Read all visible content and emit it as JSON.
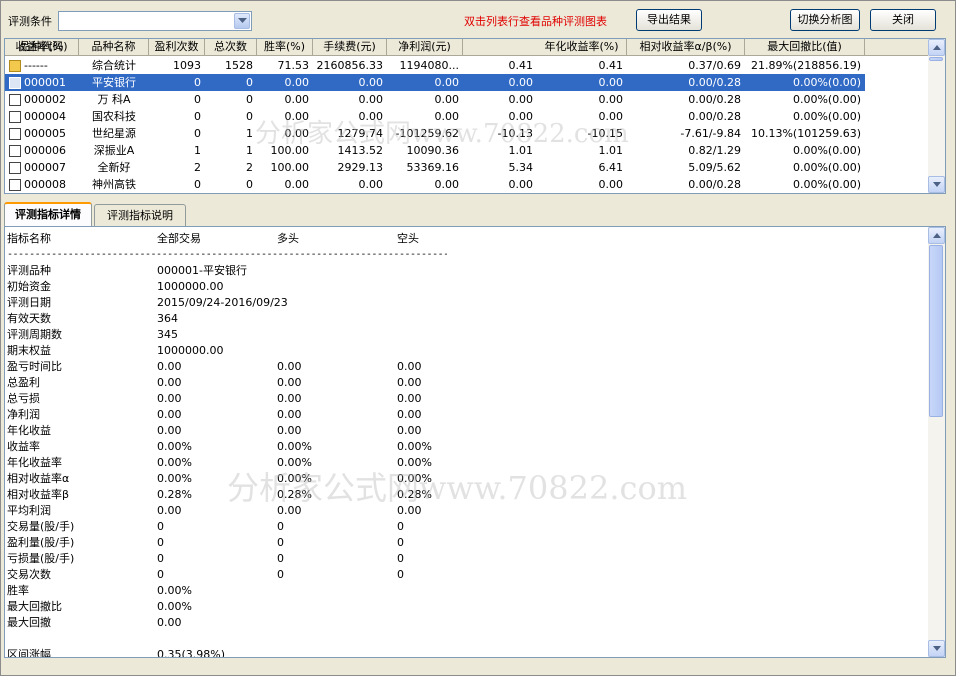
{
  "toolbar": {
    "condition_label": "评测条件",
    "condition_value": "",
    "hint": "双击列表行查看品种评测图表",
    "export_label": "导出结果",
    "switch_chart_label": "切换分析图",
    "close_label": "关闭"
  },
  "grid": {
    "columns": [
      "品种代码",
      "品种名称",
      "盈利次数",
      "总次数",
      "胜率(%)",
      "手续费(元)",
      "净利润(元)",
      "收益率(%)",
      "年化收益率(%)",
      "相对收益率α/β(%)",
      "最大回撤比(值)"
    ],
    "rows": [
      {
        "code": "------",
        "name": "综合统计",
        "wins": "1093",
        "total": "1528",
        "winrate": "71.53",
        "fee": "2160856.33",
        "profit": "1194080...",
        "ret": "0.41",
        "annual": "0.41",
        "relative": "0.37/0.69",
        "maxdd": "21.89%(218856.19)",
        "icon": "folder-icon",
        "selected": false
      },
      {
        "code": "000001",
        "name": "平安银行",
        "wins": "0",
        "total": "0",
        "winrate": "0.00",
        "fee": "0.00",
        "profit": "0.00",
        "ret": "0.00",
        "annual": "0.00",
        "relative": "0.00/0.28",
        "maxdd": "0.00%(0.00)",
        "icon": "document-icon",
        "selected": true
      },
      {
        "code": "000002",
        "name": "万 科A",
        "wins": "0",
        "total": "0",
        "winrate": "0.00",
        "fee": "0.00",
        "profit": "0.00",
        "ret": "0.00",
        "annual": "0.00",
        "relative": "0.00/0.28",
        "maxdd": "0.00%(0.00)",
        "icon": "document-icon",
        "selected": false
      },
      {
        "code": "000004",
        "name": "国农科技",
        "wins": "0",
        "total": "0",
        "winrate": "0.00",
        "fee": "0.00",
        "profit": "0.00",
        "ret": "0.00",
        "annual": "0.00",
        "relative": "0.00/0.28",
        "maxdd": "0.00%(0.00)",
        "icon": "document-icon",
        "selected": false
      },
      {
        "code": "000005",
        "name": "世纪星源",
        "wins": "0",
        "total": "1",
        "winrate": "0.00",
        "fee": "1279.74",
        "profit": "-101259.62",
        "ret": "-10.13",
        "annual": "-10.15",
        "relative": "-7.61/-9.84",
        "maxdd": "10.13%(101259.63)",
        "icon": "document-icon",
        "selected": false
      },
      {
        "code": "000006",
        "name": "深振业A",
        "wins": "1",
        "total": "1",
        "winrate": "100.00",
        "fee": "1413.52",
        "profit": "10090.36",
        "ret": "1.01",
        "annual": "1.01",
        "relative": "0.82/1.29",
        "maxdd": "0.00%(0.00)",
        "icon": "document-icon",
        "selected": false
      },
      {
        "code": "000007",
        "name": "全新好",
        "wins": "2",
        "total": "2",
        "winrate": "100.00",
        "fee": "2929.13",
        "profit": "53369.16",
        "ret": "5.34",
        "annual": "6.41",
        "relative": "5.09/5.62",
        "maxdd": "0.00%(0.00)",
        "icon": "document-icon",
        "selected": false
      },
      {
        "code": "000008",
        "name": "神州高铁",
        "wins": "0",
        "total": "0",
        "winrate": "0.00",
        "fee": "0.00",
        "profit": "0.00",
        "ret": "0.00",
        "annual": "0.00",
        "relative": "0.00/0.28",
        "maxdd": "0.00%(0.00)",
        "icon": "document-icon",
        "selected": false
      }
    ]
  },
  "tabs": [
    {
      "label": "评测指标详情",
      "active": true
    },
    {
      "label": "评测指标说明",
      "active": false
    }
  ],
  "detail": {
    "header": {
      "k": "指标名称",
      "v1": "全部交易",
      "v2": "多头",
      "v3": "空头"
    },
    "separator": "--------------------------------------------------------------------------------",
    "lines": [
      {
        "k": "评测品种",
        "v1": "000001-平安银行",
        "v2": "",
        "v3": ""
      },
      {
        "k": "初始资金",
        "v1": "1000000.00",
        "v2": "",
        "v3": ""
      },
      {
        "k": "评测日期",
        "v1": "2015/09/24-2016/09/23",
        "v2": "",
        "v3": ""
      },
      {
        "k": "有效天数",
        "v1": "364",
        "v2": "",
        "v3": ""
      },
      {
        "k": "评测周期数",
        "v1": "345",
        "v2": "",
        "v3": ""
      },
      {
        "k": "期末权益",
        "v1": "1000000.00",
        "v2": "",
        "v3": ""
      },
      {
        "k": "盈亏时间比",
        "v1": "0.00",
        "v2": "0.00",
        "v3": "0.00"
      },
      {
        "k": "总盈利",
        "v1": "0.00",
        "v2": "0.00",
        "v3": "0.00"
      },
      {
        "k": "总亏损",
        "v1": "0.00",
        "v2": "0.00",
        "v3": "0.00"
      },
      {
        "k": "净利润",
        "v1": "0.00",
        "v2": "0.00",
        "v3": "0.00"
      },
      {
        "k": "年化收益",
        "v1": "0.00",
        "v2": "0.00",
        "v3": "0.00"
      },
      {
        "k": "收益率",
        "v1": "0.00%",
        "v2": "0.00%",
        "v3": "0.00%"
      },
      {
        "k": "年化收益率",
        "v1": "0.00%",
        "v2": "0.00%",
        "v3": "0.00%"
      },
      {
        "k": "相对收益率α",
        "v1": "0.00%",
        "v2": "0.00%",
        "v3": "0.00%"
      },
      {
        "k": "相对收益率β",
        "v1": "0.28%",
        "v2": "0.28%",
        "v3": "0.28%"
      },
      {
        "k": "平均利润",
        "v1": "0.00",
        "v2": "0.00",
        "v3": "0.00"
      },
      {
        "k": "交易量(股/手)",
        "v1": "0",
        "v2": "0",
        "v3": "0"
      },
      {
        "k": "盈利量(股/手)",
        "v1": "0",
        "v2": "0",
        "v3": "0"
      },
      {
        "k": "亏损量(股/手)",
        "v1": "0",
        "v2": "0",
        "v3": "0"
      },
      {
        "k": "交易次数",
        "v1": "0",
        "v2": "0",
        "v3": "0"
      },
      {
        "k": "胜率",
        "v1": "0.00%",
        "v2": "",
        "v3": ""
      },
      {
        "k": "最大回撤比",
        "v1": "0.00%",
        "v2": "",
        "v3": ""
      },
      {
        "k": "最大回撤",
        "v1": "0.00",
        "v2": "",
        "v3": ""
      },
      {
        "k": "",
        "v1": "",
        "v2": "",
        "v3": ""
      },
      {
        "k": "区间涨幅",
        "v1": "0.35(3.98%)",
        "v2": "",
        "v3": ""
      }
    ]
  },
  "watermark": {
    "grid_text": "分析家公式网www.70822.com",
    "detail_text": "分析家公式网www.70822.com"
  },
  "colors": {
    "selection": "#316ac5",
    "hint": "#e00000",
    "window": "#ece9d8"
  }
}
